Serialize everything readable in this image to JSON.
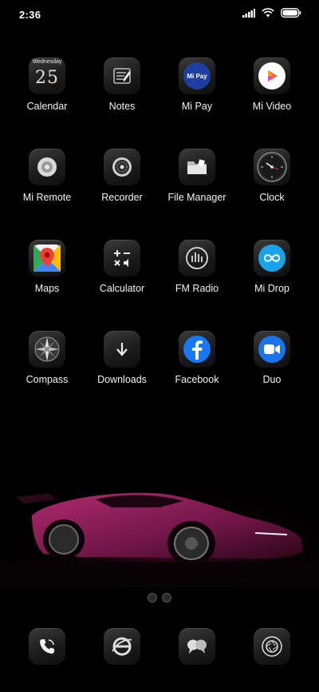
{
  "status": {
    "time": "2:36"
  },
  "apps": [
    {
      "label": "Calendar",
      "icon": "calendar-icon",
      "day": "Wednesday",
      "date": "25"
    },
    {
      "label": "Notes",
      "icon": "notes-icon"
    },
    {
      "label": "Mi Pay",
      "icon": "mi-pay-icon",
      "text": "Mi Pay"
    },
    {
      "label": "Mi Video",
      "icon": "mi-video-icon"
    },
    {
      "label": "Mi Remote",
      "icon": "mi-remote-icon"
    },
    {
      "label": "Recorder",
      "icon": "recorder-icon"
    },
    {
      "label": "File Manager",
      "icon": "file-manager-icon"
    },
    {
      "label": "Clock",
      "icon": "clock-icon"
    },
    {
      "label": "Maps",
      "icon": "maps-icon"
    },
    {
      "label": "Calculator",
      "icon": "calculator-icon"
    },
    {
      "label": "FM Radio",
      "icon": "fm-radio-icon"
    },
    {
      "label": "Mi Drop",
      "icon": "mi-drop-icon"
    },
    {
      "label": "Compass",
      "icon": "compass-icon"
    },
    {
      "label": "Downloads",
      "icon": "downloads-icon"
    },
    {
      "label": "Facebook",
      "icon": "facebook-icon"
    },
    {
      "label": "Duo",
      "icon": "duo-icon"
    }
  ],
  "dock": [
    {
      "icon": "phone-icon"
    },
    {
      "icon": "browser-icon"
    },
    {
      "icon": "messages-icon"
    },
    {
      "icon": "camera-icon"
    }
  ],
  "page_indicator": {
    "pages": 2,
    "current": 1
  },
  "colors": {
    "background": "#000000",
    "label": "#f2f2f2",
    "tile": "#1c1c1c",
    "wallpaper_car": "#8a1f5a"
  }
}
